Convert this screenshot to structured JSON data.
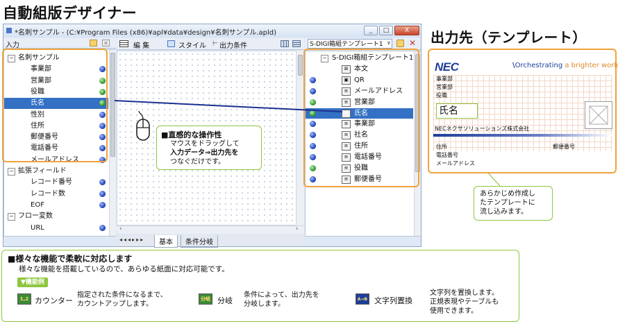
{
  "main_heading": "自動組版デザイナー",
  "output_heading": "出力先（テンプレート）",
  "window": {
    "title": "*名刺サンプル - (C:¥Program Files (x86)¥apl¥data¥design¥名刺サンプル.apld)",
    "buttons": [
      "_",
      "□",
      "X"
    ]
  },
  "input_panel": {
    "title": "入力",
    "rows": [
      {
        "type": "group",
        "label": "名刺サンプル"
      },
      {
        "type": "item",
        "label": "事業部",
        "dot": "blue"
      },
      {
        "type": "item",
        "label": "営業部",
        "dot": "green"
      },
      {
        "type": "item",
        "label": "役職",
        "dot": "green"
      },
      {
        "type": "item",
        "label": "氏名",
        "dot": "green",
        "selected": true
      },
      {
        "type": "item",
        "label": "性別",
        "dot": "blue"
      },
      {
        "type": "item",
        "label": "住所",
        "dot": "blue"
      },
      {
        "type": "item",
        "label": "郵便番号",
        "dot": "blue"
      },
      {
        "type": "item",
        "label": "電話番号",
        "dot": "blue"
      },
      {
        "type": "item",
        "label": "メールアドレス",
        "dot": "blue"
      },
      {
        "type": "group",
        "label": "拡張フィールド"
      },
      {
        "type": "item",
        "label": "レコード番号",
        "dot": "blue"
      },
      {
        "type": "item",
        "label": "レコード数",
        "dot": "blue"
      },
      {
        "type": "item",
        "label": "EOF",
        "dot": "blue"
      },
      {
        "type": "group",
        "label": "フロー変数"
      },
      {
        "type": "item",
        "label": "URL",
        "dot": "blue"
      }
    ]
  },
  "center_toolbar": {
    "edit_label": "編 集",
    "style_label": "スタイル",
    "output_cond_label": "出力条件"
  },
  "center_tabs": [
    "基本",
    "条件分岐"
  ],
  "callout_mouse": {
    "title": "■直感的な操作性",
    "line1": "マウスをドラッグして",
    "line2": "入力データ⇒出力先を",
    "line3": "つなぐだけです。"
  },
  "right_panel": {
    "dropdown": "S-DIGI箱組テンプレート1",
    "root": "S-DIGI箱組テンプレート1",
    "rows": [
      {
        "label": "本文",
        "dot": "none",
        "icon": "table"
      },
      {
        "label": "QR",
        "dot": "blue",
        "icon": "qr"
      },
      {
        "label": "メールアドレス",
        "dot": "blue",
        "icon": "field"
      },
      {
        "label": "営業部",
        "dot": "green",
        "icon": "field"
      },
      {
        "label": "氏名",
        "dot": "green",
        "icon": "field",
        "selected": true
      },
      {
        "label": "事業部",
        "dot": "blue",
        "icon": "field"
      },
      {
        "label": "社名",
        "dot": "blue",
        "icon": "field"
      },
      {
        "label": "住所",
        "dot": "blue",
        "icon": "field"
      },
      {
        "label": "電話番号",
        "dot": "blue",
        "icon": "field"
      },
      {
        "label": "役職",
        "dot": "green",
        "icon": "field"
      },
      {
        "label": "郵便番号",
        "dot": "blue",
        "icon": "field"
      }
    ]
  },
  "card": {
    "logo": "NEC",
    "tagline_main": "Orchestrating",
    "tagline_accent": "a brighter world",
    "field_jigyobu": "事業部",
    "field_eigyobu": "営業部",
    "field_yakushoku": "役職",
    "field_shimei": "氏名",
    "company": "NECネクサソリューションズ株式会社",
    "field_jusho": "住所",
    "field_yubin": "郵便番号",
    "field_denwa": "電話番号",
    "field_mail": "メールアドレス"
  },
  "callout_template": {
    "line1": "あらかじめ作成し",
    "line2": "たテンプレートに",
    "line3": "流し込みます。"
  },
  "features": {
    "title": "■様々な機能で柔軟に対応します",
    "subtitle": "様々な機能を搭載しているので、あらゆる紙面に対応可能です。",
    "tag": "▼機能例",
    "items": [
      {
        "icon_text": "1,2",
        "name": "カウンター",
        "desc1": "指定された条件になるまで、",
        "desc2": "カウントアップします。",
        "desc3": ""
      },
      {
        "icon_text": "分岐",
        "name": "分岐",
        "desc1": "条件によって、出力先を",
        "desc2": "分岐します。",
        "desc3": ""
      },
      {
        "icon_text": "A→B",
        "name": "文字列置換",
        "desc1": "文字列を置換します。",
        "desc2": "正規表現やテーブルも",
        "desc3": "使用できます。"
      }
    ]
  },
  "colors": {
    "accent_orange": "#f0a23a",
    "callout_green": "#8dc63f",
    "selection_blue": "#3471c4",
    "nec_blue": "#1d3f9b"
  }
}
